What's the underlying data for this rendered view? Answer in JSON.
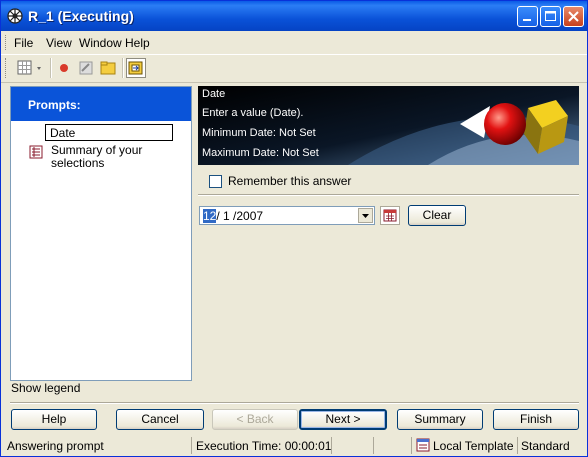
{
  "window": {
    "title": "R_1 (Executing)"
  },
  "menu": [
    "File",
    "View",
    "Window",
    "Help"
  ],
  "toolbar": {
    "icons": [
      "grid-view-icon",
      "record-icon",
      "clear-icon",
      "folder-icon",
      "export-icon"
    ]
  },
  "prompts_panel": {
    "header": "Prompts:",
    "items": [
      {
        "label": "Date"
      },
      {
        "label": "Summary of your selections"
      }
    ],
    "show_legend": "Show legend"
  },
  "prompt": {
    "title": "Date",
    "instruction": "Enter a value (Date).",
    "min_date": "Minimum Date: Not Set",
    "max_date": "Maximum Date: Not Set",
    "remember_label": "Remember this answer",
    "value_highlight": "12",
    "value_rest": "/ 1 /2007",
    "clear_label": "Clear"
  },
  "buttons": {
    "help": "Help",
    "cancel": "Cancel",
    "back": "< Back",
    "next": "Next >",
    "summary": "Summary",
    "finish": "Finish"
  },
  "status": {
    "message": "Answering prompt",
    "execution_time": "Execution Time: 00:00:01",
    "template": "Local Template",
    "mode": "Standard"
  }
}
